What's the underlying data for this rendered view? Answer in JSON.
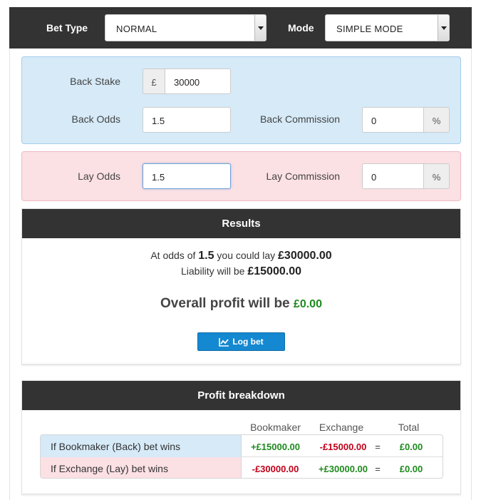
{
  "topbar": {
    "bet_type_label": "Bet Type",
    "bet_type_value": "NORMAL",
    "mode_label": "Mode",
    "mode_value": "SIMPLE MODE"
  },
  "back": {
    "stake_label": "Back Stake",
    "currency": "£",
    "stake_value": "30000",
    "odds_label": "Back Odds",
    "odds_value": "1.5",
    "commission_label": "Back Commission",
    "commission_value": "0",
    "percent": "%"
  },
  "lay": {
    "odds_label": "Lay Odds",
    "odds_value": "1.5",
    "commission_label": "Lay Commission",
    "commission_value": "0",
    "percent": "%"
  },
  "results": {
    "title": "Results",
    "line1_prefix": "At odds of",
    "odds": "1.5",
    "line1_mid": "you could lay",
    "lay_amount": "£30000.00",
    "line2_prefix": "Liability will be",
    "liability": "£15000.00",
    "profit_prefix": "Overall profit will be",
    "profit_value": "£0.00",
    "log_button": "Log bet"
  },
  "breakdown": {
    "title": "Profit breakdown",
    "columns": [
      "Bookmaker",
      "Exchange",
      "Total"
    ],
    "rows": [
      {
        "label": "If Bookmaker (Back) bet wins",
        "bookmaker": "+£15000.00",
        "exchange": "-£15000.00",
        "eq": "=",
        "total": "£0.00"
      },
      {
        "label": "If Exchange (Lay) bet wins",
        "bookmaker": "-£30000.00",
        "exchange": "+£30000.00",
        "eq": "=",
        "total": "£0.00"
      }
    ]
  },
  "colors": {
    "positive": "#1e8a1e",
    "negative": "#c0001a",
    "button": "#1488d0",
    "header": "#333333"
  }
}
